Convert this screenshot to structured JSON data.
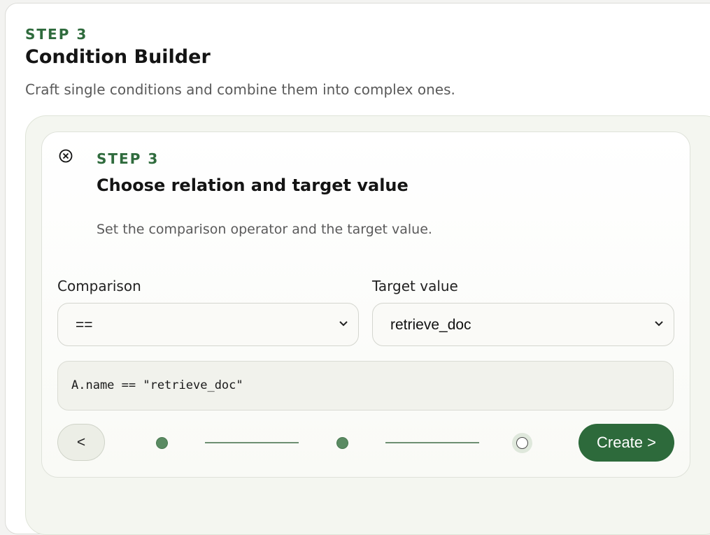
{
  "header": {
    "step_label": "STEP 3",
    "title": "Condition Builder",
    "subtitle": "Craft single conditions and combine them into complex ones."
  },
  "wizard": {
    "close_icon": "close-circle-icon",
    "step_label": "STEP 3",
    "title": "Choose relation and target value",
    "description": "Set the comparison operator and the target value.",
    "comparison": {
      "label": "Comparison",
      "value": "=="
    },
    "target": {
      "label": "Target value",
      "value": "retrieve_doc"
    },
    "expression": "A.name == \"retrieve_doc\"",
    "back_label": "<",
    "create_label": "Create >",
    "progress": {
      "total_steps": 3,
      "current_step": 3
    }
  },
  "colors": {
    "accent": "#2d6a3b",
    "step_label": "#2f6b3d",
    "done_dot": "#5a8a62"
  }
}
